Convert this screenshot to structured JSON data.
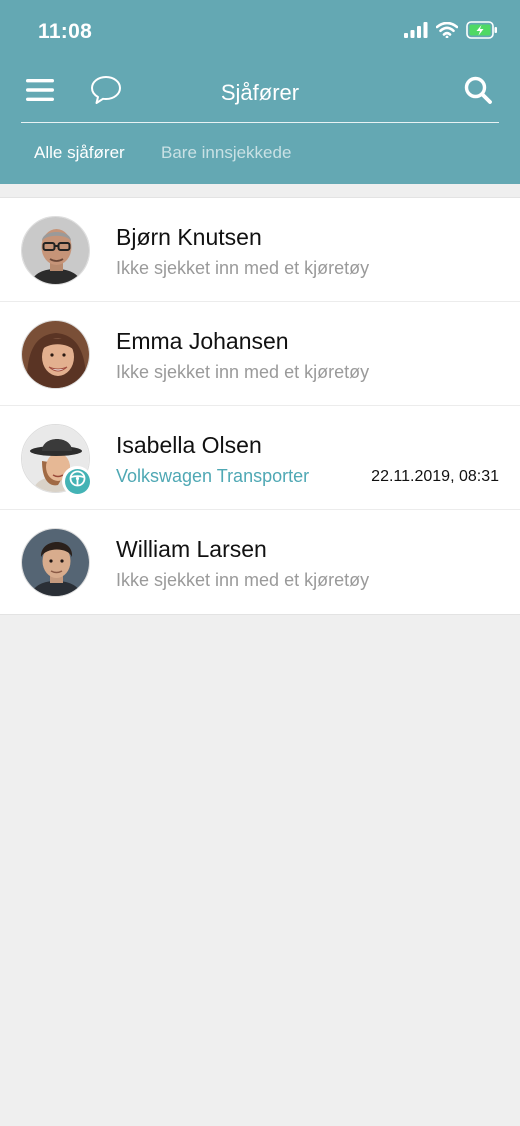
{
  "status_bar": {
    "time": "11:08"
  },
  "header": {
    "title": "Sjåfører",
    "tabs": [
      {
        "label": "Alle sjåfører",
        "active": true
      },
      {
        "label": "Bare innsjekkede",
        "active": false
      }
    ]
  },
  "drivers": [
    {
      "name": "Bjørn Knutsen",
      "subtitle": "Ikke sjekket inn med et kjøretøy",
      "checked_in": false,
      "timestamp": ""
    },
    {
      "name": "Emma Johansen",
      "subtitle": "Ikke sjekket inn med et kjøretøy",
      "checked_in": false,
      "timestamp": ""
    },
    {
      "name": "Isabella Olsen",
      "subtitle": "Volkswagen Transporter",
      "checked_in": true,
      "timestamp": "22.11.2019, 08:31"
    },
    {
      "name": "William Larsen",
      "subtitle": "Ikke sjekket inn med et kjøretøy",
      "checked_in": false,
      "timestamp": ""
    }
  ],
  "colors": {
    "header": "#64a8b3",
    "accent": "#44b3b5",
    "vehicle_text": "#4fa8b4",
    "background": "#efefef"
  },
  "icons": [
    "menu-icon",
    "chat-bubble-icon",
    "search-icon",
    "signal-icon",
    "wifi-icon",
    "battery-icon",
    "steering-wheel-icon"
  ]
}
